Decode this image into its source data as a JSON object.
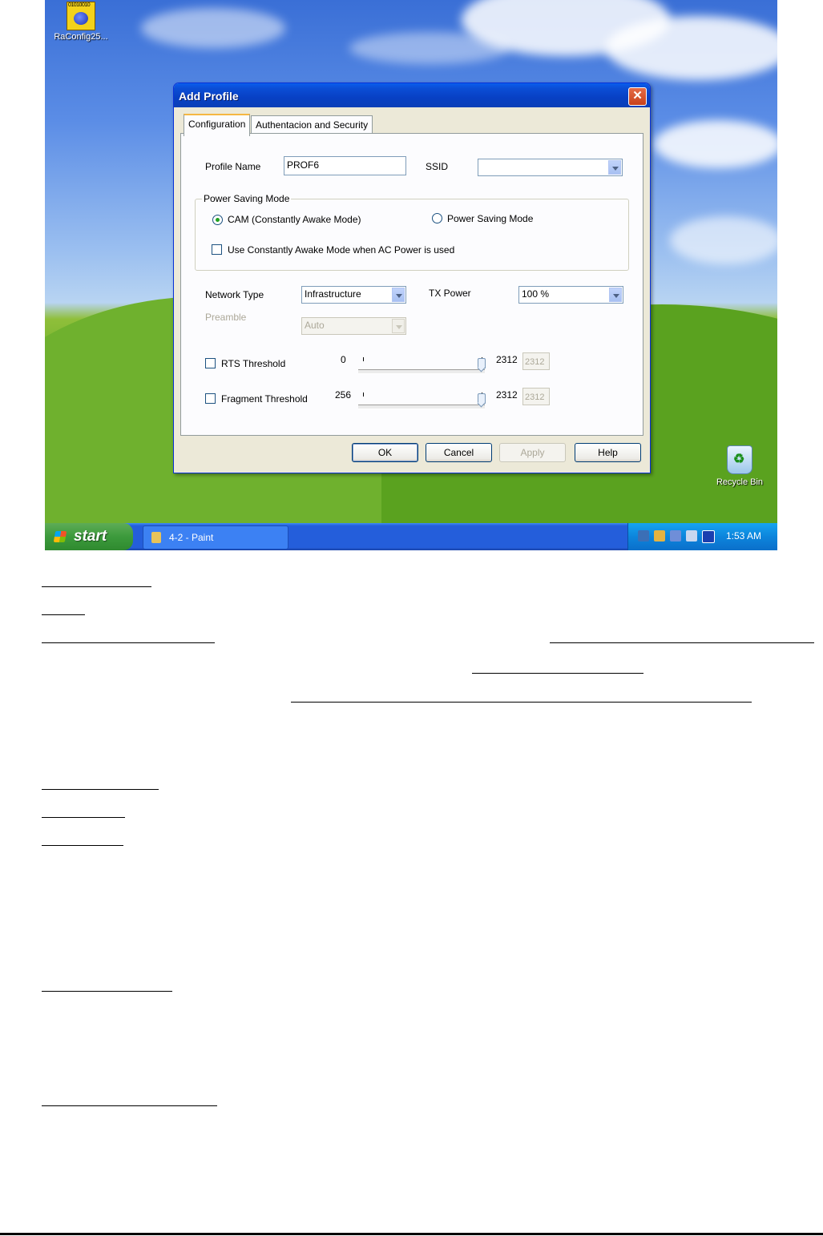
{
  "desktop": {
    "icons": [
      {
        "label": "RaConfig25...",
        "bits": "01010010"
      },
      {
        "label": "Recycle Bin"
      }
    ]
  },
  "dialog": {
    "title": "Add Profile",
    "close_glyph": "✕",
    "tabs": [
      "Configuration",
      "Authentacion and Security"
    ],
    "profile_name_label": "Profile Name",
    "profile_name_value": "PROF6",
    "ssid_label": "SSID",
    "ssid_value": "",
    "power_saving_group_label": "Power Saving Mode",
    "radio_cam_label": "CAM (Constantly Awake Mode)",
    "radio_cam_checked": true,
    "radio_psm_label": "Power Saving Mode",
    "radio_psm_checked": false,
    "use_cam_ac_label": "Use Constantly Awake Mode when AC Power is used",
    "use_cam_ac_checked": false,
    "network_type_label": "Network Type",
    "network_type_value": "Infrastructure",
    "tx_power_label": "TX Power",
    "tx_power_value": "100 %",
    "preamble_label": "Preamble",
    "preamble_value": "Auto",
    "rts_label": "RTS Threshold",
    "rts_checked": false,
    "rts_min": "0",
    "rts_max": "2312",
    "rts_value": "2312",
    "frag_label": "Fragment Threshold",
    "frag_checked": false,
    "frag_min": "256",
    "frag_max": "2312",
    "frag_value": "2312",
    "buttons": {
      "ok": "OK",
      "cancel": "Cancel",
      "apply": "Apply",
      "help": "Help"
    }
  },
  "taskbar": {
    "start_label": "start",
    "task_item": "4-2 - Paint",
    "clock": "1:53 AM"
  },
  "colors": {
    "titlebar": "#0a4fd6",
    "dialog_bg": "#ece9d8",
    "taskbar": "#245edb",
    "start_green": "#3c9a3c"
  }
}
